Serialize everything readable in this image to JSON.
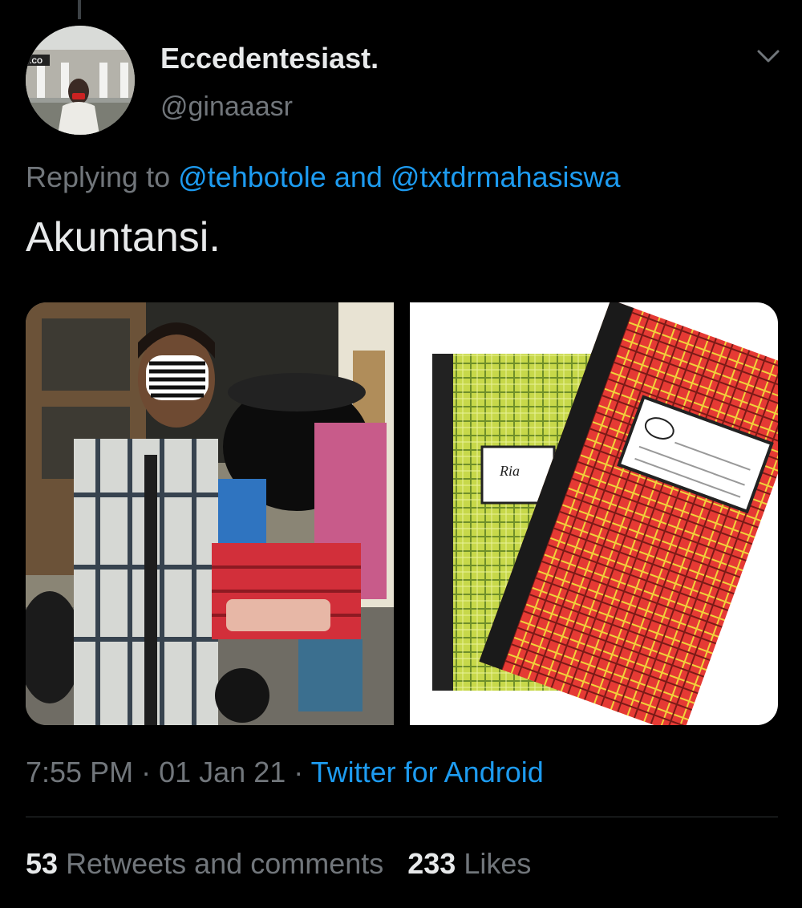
{
  "tweet": {
    "author": {
      "display_name": "Eccedentesiast.",
      "handle": "@ginaaasr",
      "avatar_sign_text": ".CO"
    },
    "replying": {
      "prefix": "Replying to",
      "mention1": "@tehbotole",
      "joiner": "and",
      "mention2": "@txtdrmahasiswa"
    },
    "text": "Akuntansi.",
    "media": [
      {
        "icon": "photo-person-with-basket"
      },
      {
        "icon": "photo-plaid-notebooks",
        "brand_label": "Ria"
      }
    ],
    "meta": {
      "time": "7:55 PM",
      "date": "01 Jan 21",
      "separator": "·",
      "source": "Twitter for Android"
    },
    "stats": {
      "retweets_count": "53",
      "retweets_label": "Retweets and comments",
      "likes_count": "233",
      "likes_label": "Likes"
    }
  },
  "colors": {
    "background": "#000000",
    "primary_text": "#e7e9ea",
    "secondary_text": "#71767b",
    "link": "#1d9bf0"
  }
}
